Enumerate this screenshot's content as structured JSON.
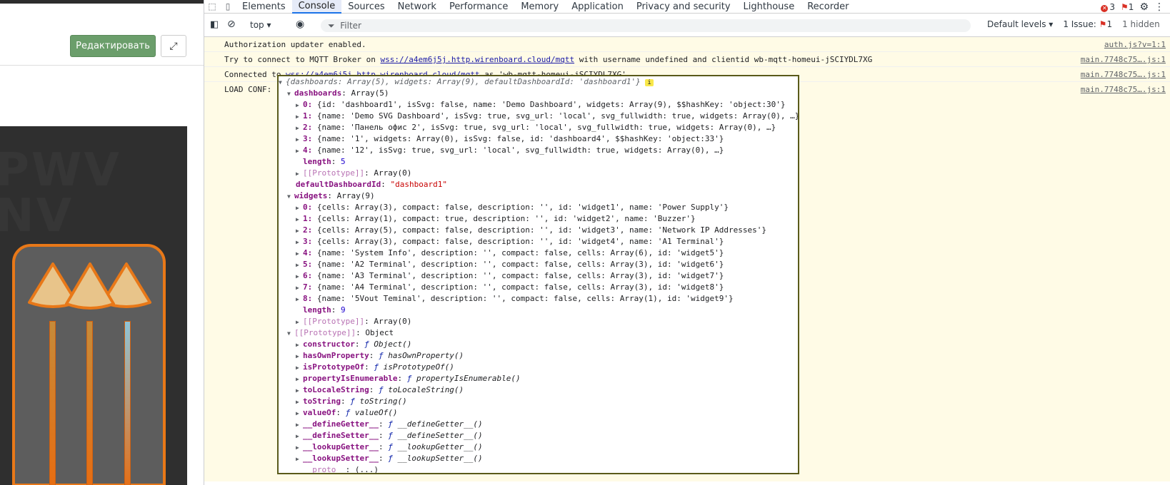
{
  "left": {
    "edit_label": "Редактировать",
    "fullscreen_icon": "expand-icon"
  },
  "devtools": {
    "tabs": [
      "Elements",
      "Console",
      "Sources",
      "Network",
      "Performance",
      "Memory",
      "Application",
      "Privacy and security",
      "Lighthouse",
      "Recorder"
    ],
    "errors": "3",
    "warnings": "1",
    "toolbar": {
      "context": "top",
      "filter_placeholder": "Filter",
      "levels": "Default levels",
      "issues": "1 Issue:",
      "issues_count": "1",
      "hidden": "1 hidden"
    },
    "messages": [
      {
        "text": "Authorization updater enabled.",
        "source": "auth.js?v=1:1"
      },
      {
        "pre": "Try to connect to MQTT Broker on ",
        "link": "wss://a4em6j5j.http.wirenboard.cloud/mqtt",
        "post": " with username undefined and clientid wb-mqtt-homeui-jSCIYDL7XG",
        "source": "main.7748c75….js:1"
      },
      {
        "pre": "Connected to ",
        "link": "wss://a4em6j5j.http.wirenboard.cloud/mqtt",
        "post": " as 'wb-mqtt-homeui-jSCIYDL7XG'",
        "source": "main.7748c75….js:1"
      },
      {
        "pre": "LOAD CONF:",
        "source": "main.7748c75….js:1"
      }
    ],
    "tree": {
      "summary": "{dashboards: Array(5), widgets: Array(9), defaultDashboardId: 'dashboard1'}",
      "dashboards_label": "dashboards",
      "dashboards_type": "Array(5)",
      "dashboards": [
        "{id: 'dashboard1', isSvg: false, name: 'Demo Dashboard', widgets: Array(9), $$hashKey: 'object:30'}",
        "{name: 'Demo SVG Dashboard', isSvg: true, svg_url: 'local', svg_fullwidth: true, widgets: Array(0), …}",
        "{name: 'Панель офис 2', isSvg: true, svg_url: 'local', svg_fullwidth: true, widgets: Array(0), …}",
        "{name: '1', widgets: Array(0), isSvg: false, id: 'dashboard4', $$hashKey: 'object:33'}",
        "{name: '12', isSvg: true, svg_url: 'local', svg_fullwidth: true, widgets: Array(0), …}"
      ],
      "length_label": "length",
      "dashboards_length": "5",
      "proto_label": "[[Prototype]]",
      "array_proto": "Array(0)",
      "default_key": "defaultDashboardId",
      "default_value": "\"dashboard1\"",
      "widgets_label": "widgets",
      "widgets_type": "Array(9)",
      "widgets": [
        "{cells: Array(3), compact: false, description: '', id: 'widget1', name: 'Power Supply'}",
        "{cells: Array(1), compact: true, description: '', id: 'widget2', name: 'Buzzer'}",
        "{cells: Array(5), compact: false, description: '', id: 'widget3', name: 'Network IP Addresses'}",
        "{cells: Array(3), compact: false, description: '', id: 'widget4', name: 'A1 Terminal'}",
        "{name: 'System Info', description: '', compact: false, cells: Array(6), id: 'widget5'}",
        "{name: 'A2 Terminal', description: '', compact: false, cells: Array(3), id: 'widget6'}",
        "{name: 'A3 Terminal', description: '', compact: false, cells: Array(3), id: 'widget7'}",
        "{name: 'A4 Terminal', description: '', compact: false, cells: Array(3), id: 'widget8'}",
        "{name: '5Vout Teminal', description: '', compact: false, cells: Array(1), id: 'widget9'}"
      ],
      "widgets_length": "9",
      "object_proto": "Object",
      "methods": [
        {
          "k": "constructor",
          "v": "Object()"
        },
        {
          "k": "hasOwnProperty",
          "v": "hasOwnProperty()"
        },
        {
          "k": "isPrototypeOf",
          "v": "isPrototypeOf()"
        },
        {
          "k": "propertyIsEnumerable",
          "v": "propertyIsEnumerable()"
        },
        {
          "k": "toLocaleString",
          "v": "toLocaleString()"
        },
        {
          "k": "toString",
          "v": "toString()"
        },
        {
          "k": "valueOf",
          "v": "valueOf()"
        },
        {
          "k": "__defineGetter__",
          "v": "__defineGetter__()"
        },
        {
          "k": "__defineSetter__",
          "v": "__defineSetter__()"
        },
        {
          "k": "__lookupGetter__",
          "v": "__lookupGetter__()"
        },
        {
          "k": "__lookupSetter__",
          "v": "__lookupSetter__()"
        }
      ],
      "proto_getter": "__proto__",
      "proto_getter_value": "(...)"
    }
  }
}
